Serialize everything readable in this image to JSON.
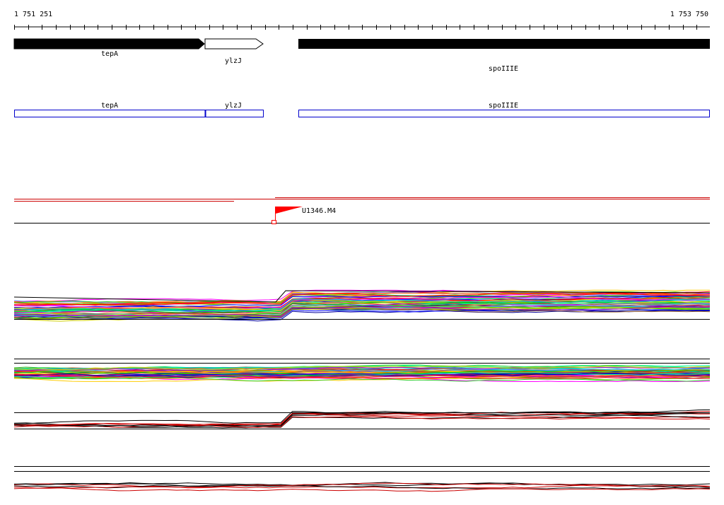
{
  "ruler": {
    "start_label": "1 751 251",
    "end_label": "1 753 750"
  },
  "genes": [
    {
      "name": "tepA",
      "strand": "+",
      "style": "filled"
    },
    {
      "name": "ylzJ",
      "strand": "+",
      "style": "outline"
    },
    {
      "name": "spoIIIE",
      "strand": "+",
      "style": "filled"
    }
  ],
  "transcripts": [
    {
      "label": "tepA"
    },
    {
      "label": "ylzJ"
    },
    {
      "label": "spoIIIE"
    }
  ],
  "marker": {
    "label": "U1346.M4",
    "flag_color": "#ff0000"
  },
  "colors": {
    "gene_filled": "#000000",
    "transcript_outline": "#0000cc",
    "segment_line": "#cc0000",
    "track_line": "#000000",
    "profile_palette": [
      "#00cc00",
      "#0000ff",
      "#ff00ff",
      "#ffcc00",
      "#00cccc",
      "#ff0000",
      "#9900cc",
      "#33cc33",
      "#ff6600",
      "#000099",
      "#cccc00",
      "#00ff99",
      "#cc0066",
      "#6699ff",
      "#996633",
      "#66cc00"
    ]
  }
}
